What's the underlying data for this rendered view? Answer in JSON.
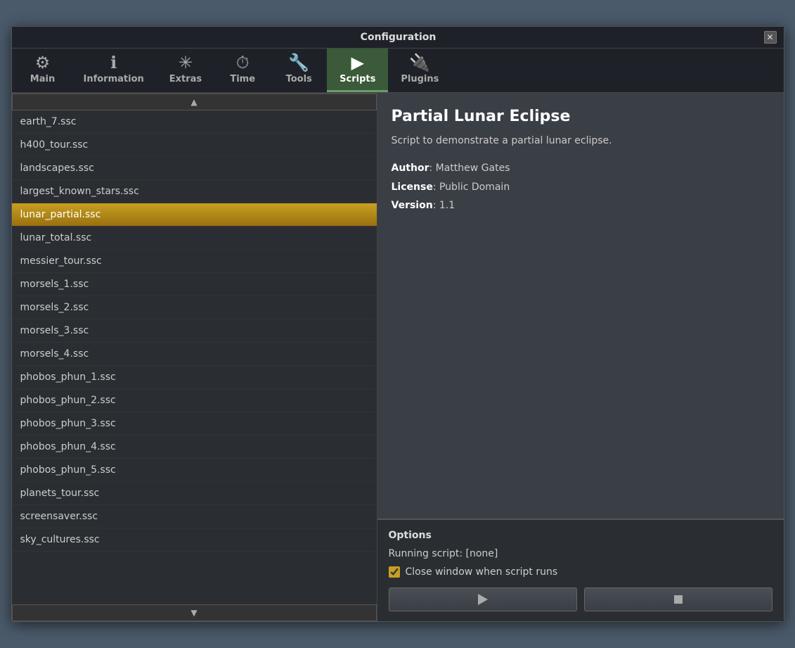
{
  "window": {
    "title": "Configuration",
    "close_label": "✕"
  },
  "tabs": [
    {
      "id": "main",
      "label": "Main",
      "icon": "⚙",
      "active": false
    },
    {
      "id": "information",
      "label": "Information",
      "icon": "ℹ",
      "active": false
    },
    {
      "id": "extras",
      "label": "Extras",
      "icon": "✳",
      "active": false
    },
    {
      "id": "time",
      "label": "Time",
      "icon": "⏱",
      "active": false
    },
    {
      "id": "tools",
      "label": "Tools",
      "icon": "🔧",
      "active": false
    },
    {
      "id": "scripts",
      "label": "Scripts",
      "icon": "▶",
      "active": true
    },
    {
      "id": "plugins",
      "label": "Plugins",
      "icon": "🔌",
      "active": false
    }
  ],
  "file_list": {
    "items": [
      "earth_7.ssc",
      "h400_tour.ssc",
      "landscapes.ssc",
      "largest_known_stars.ssc",
      "lunar_partial.ssc",
      "lunar_total.ssc",
      "messier_tour.ssc",
      "morsels_1.ssc",
      "morsels_2.ssc",
      "morsels_3.ssc",
      "morsels_4.ssc",
      "phobos_phun_1.ssc",
      "phobos_phun_2.ssc",
      "phobos_phun_3.ssc",
      "phobos_phun_4.ssc",
      "phobos_phun_5.ssc",
      "planets_tour.ssc",
      "screensaver.ssc",
      "sky_cultures.ssc"
    ],
    "selected_index": 4
  },
  "detail": {
    "title": "Partial Lunar Eclipse",
    "description": "Script to demonstrate a partial lunar eclipse.",
    "author_label": "Author",
    "author_value": "Matthew Gates",
    "license_label": "License",
    "license_value": "Public Domain",
    "version_label": "Version",
    "version_value": "1.1"
  },
  "options": {
    "title": "Options",
    "running_script_label": "Running script: [none]",
    "checkbox_label": "Close window when script runs",
    "checkbox_checked": true,
    "play_button_label": "",
    "stop_button_label": ""
  }
}
